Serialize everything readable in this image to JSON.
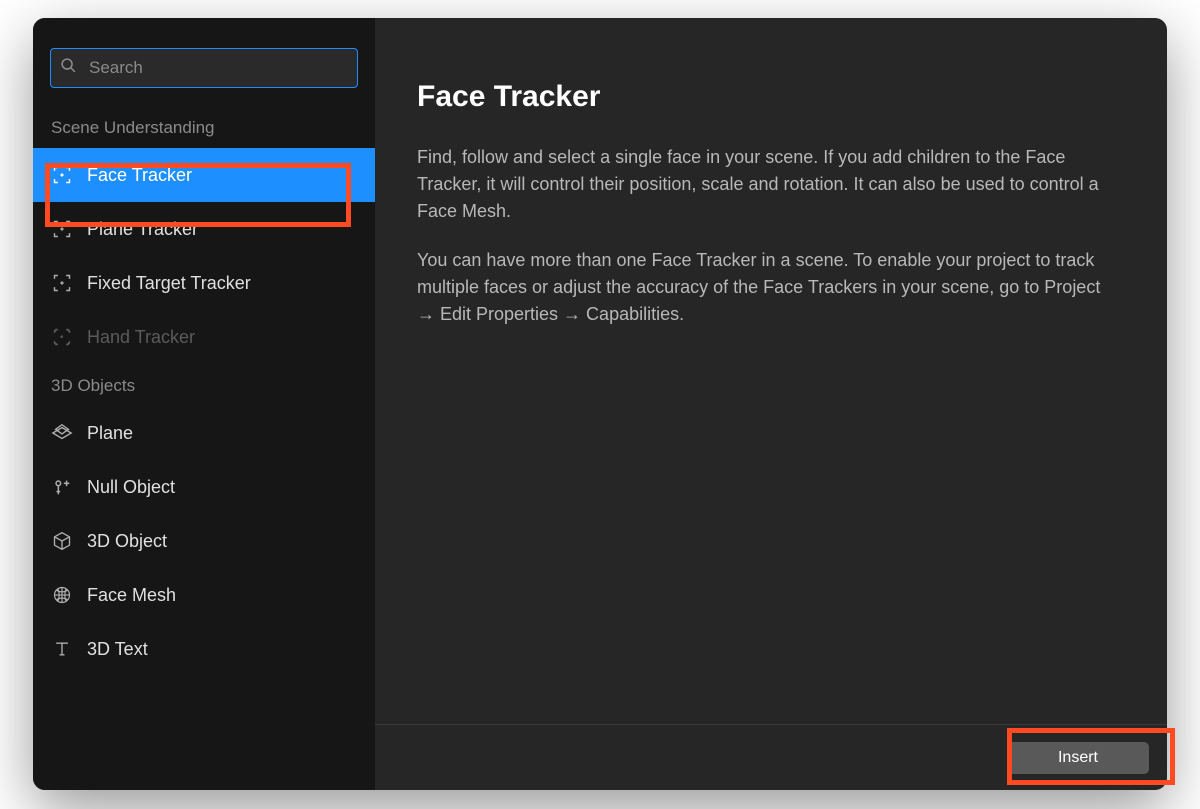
{
  "search": {
    "placeholder": "Search"
  },
  "sidebar": {
    "sections": [
      {
        "header": "Scene Understanding",
        "items": [
          {
            "label": "Face Tracker",
            "icon": "face-tracker-icon",
            "selected": true,
            "disabled": false
          },
          {
            "label": "Plane Tracker",
            "icon": "plane-tracker-icon",
            "selected": false,
            "disabled": false
          },
          {
            "label": "Fixed Target Tracker",
            "icon": "fixed-target-tracker-icon",
            "selected": false,
            "disabled": false
          },
          {
            "label": "Hand Tracker",
            "icon": "hand-tracker-icon",
            "selected": false,
            "disabled": true
          }
        ]
      },
      {
        "header": "3D Objects",
        "items": [
          {
            "label": "Plane",
            "icon": "plane-icon",
            "selected": false,
            "disabled": false
          },
          {
            "label": "Null Object",
            "icon": "null-object-icon",
            "selected": false,
            "disabled": false
          },
          {
            "label": "3D Object",
            "icon": "cube-icon",
            "selected": false,
            "disabled": false
          },
          {
            "label": "Face Mesh",
            "icon": "face-mesh-icon",
            "selected": false,
            "disabled": false
          },
          {
            "label": "3D Text",
            "icon": "text-icon",
            "selected": false,
            "disabled": false
          }
        ]
      }
    ]
  },
  "content": {
    "title": "Face Tracker",
    "paragraph1": "Find, follow and select a single face in your scene. If you add children to the Face Tracker, it will control their position, scale and rotation. It can also be used to control a Face Mesh.",
    "paragraph2": "You can have more than one Face Tracker in a scene. To enable your project to track multiple faces or adjust the accuracy of the Face Trackers in your scene, go to Project → Edit Properties → Capabilities."
  },
  "footer": {
    "insert_label": "Insert"
  }
}
